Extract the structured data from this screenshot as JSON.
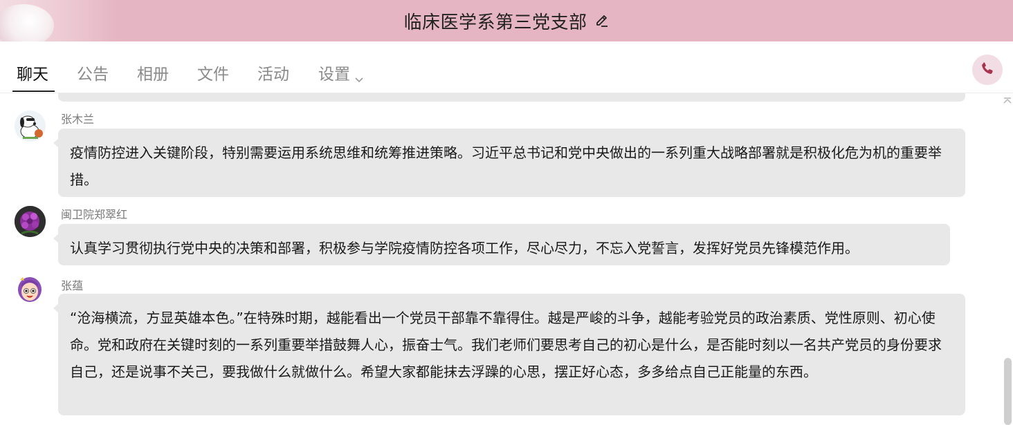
{
  "header": {
    "title": "临床医学系第三党支部",
    "edit_icon": "pencil-icon",
    "background_color": "#e5b5c3"
  },
  "tabs": [
    {
      "label": "聊天",
      "active": true
    },
    {
      "label": "公告",
      "active": false
    },
    {
      "label": "相册",
      "active": false
    },
    {
      "label": "文件",
      "active": false
    },
    {
      "label": "活动",
      "active": false
    },
    {
      "label": "设置",
      "active": false,
      "has_dropdown": true
    }
  ],
  "call_button": {
    "icon": "phone-icon",
    "accent_color": "#a8334f"
  },
  "messages": [
    {
      "sender": "张木兰",
      "avatar": "snoopy-avatar",
      "text": "疫情防控进入关键阶段，特别需要运用系统思维和统筹推进策略。习近平总书记和党中央做出的一系列重大战略部署就是积极化危为机的重要举措。"
    },
    {
      "sender": "闽卫院郑翠红",
      "avatar": "purple-flower-avatar",
      "text": "认真学习贯彻执行党中央的决策和部署，积极参与学院疫情防控各项工作，尽心尽力，不忘入党誓言，发挥好党员先锋模范作用。"
    },
    {
      "sender": "张蕴",
      "avatar": "cartoon-girl-avatar",
      "text": "“沧海横流，方显英雄本色。”在特殊时期，越能看出一个党员干部靠不靠得住。越是严峻的斗争，越能考验党员的政治素质、党性原则、初心使命。党和政府在关键时刻的一系列重要举措鼓舞人心，振奋士气。我们老师们要思考自己的初心是什么，是否能时刻以一名共产党员的身份要求自己，还是说事不关己，要我做什么就做什么。希望大家都能抹去浮躁的心思，摆正好心态，多多给点自己正能量的东西。"
    }
  ]
}
